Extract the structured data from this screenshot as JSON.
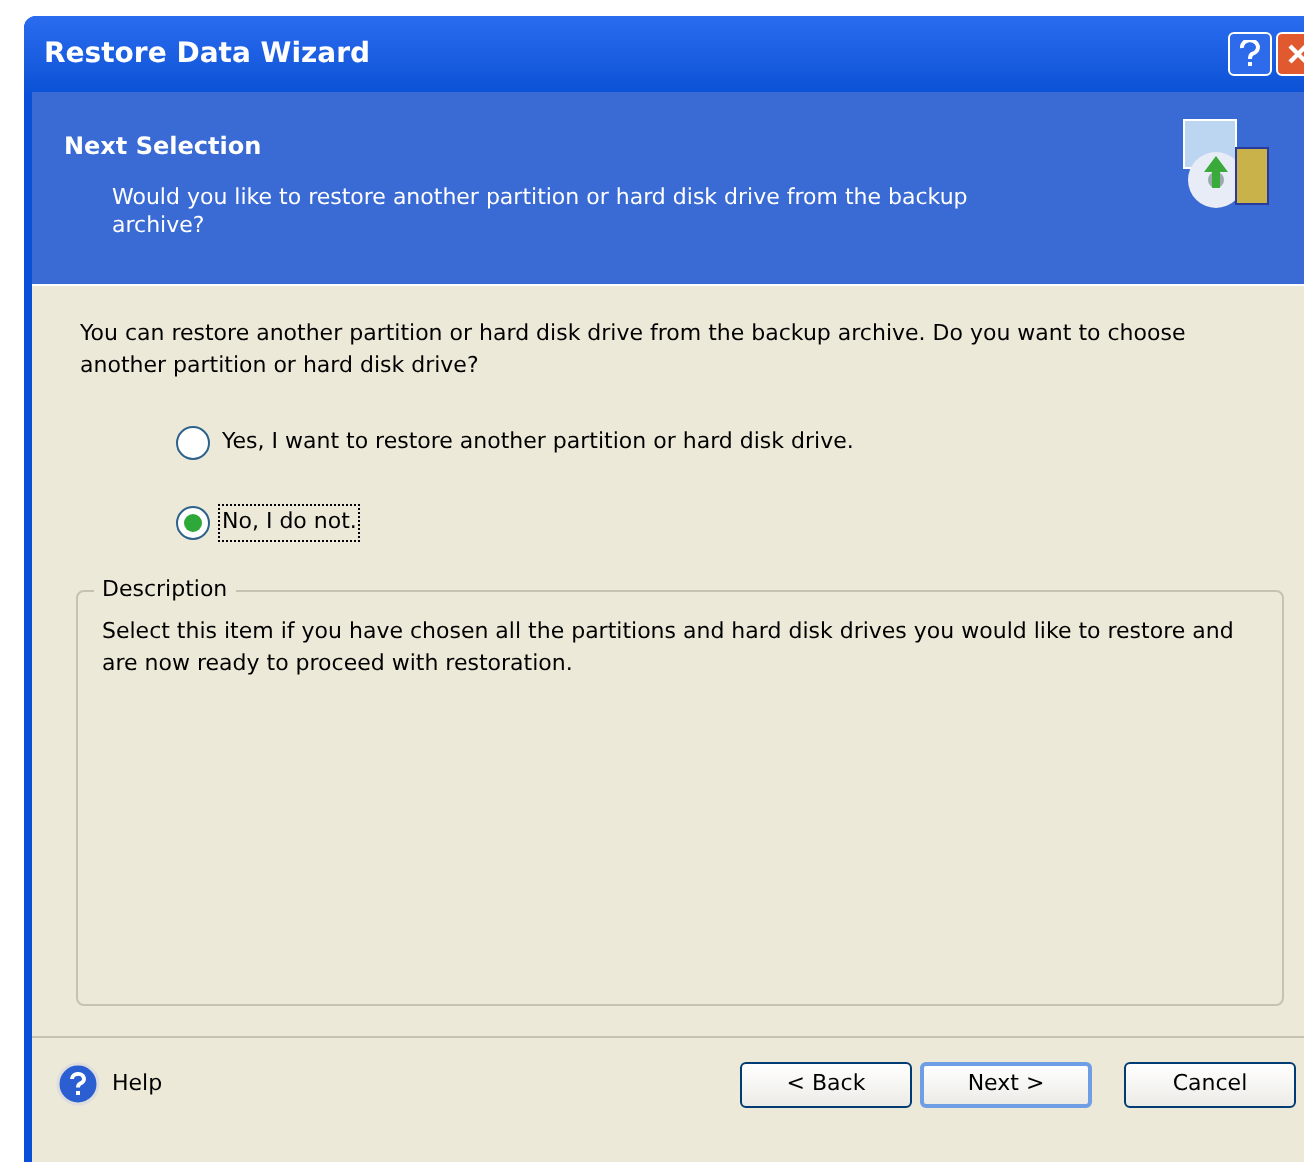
{
  "window": {
    "title": "Restore Data Wizard"
  },
  "header": {
    "title": "Next Selection",
    "subtitle": "Would you like to restore another partition or hard disk drive from the backup archive?"
  },
  "intro": "You can restore another partition or hard disk drive from the backup archive. Do you want to choose another partition or hard disk drive?",
  "options": [
    {
      "label": "Yes, I want to restore another partition or hard disk drive.",
      "selected": false
    },
    {
      "label": "No, I do not.",
      "selected": true
    }
  ],
  "description": {
    "title": "Description",
    "text": "Select this item if you have chosen all the partitions and hard disk drives you would like to restore and are now ready to proceed with restoration."
  },
  "help": "Help",
  "buttons": [
    {
      "label": "< Back",
      "default": false
    },
    {
      "label": "Next >",
      "default": true
    },
    {
      "label": "Cancel",
      "default": false
    }
  ]
}
